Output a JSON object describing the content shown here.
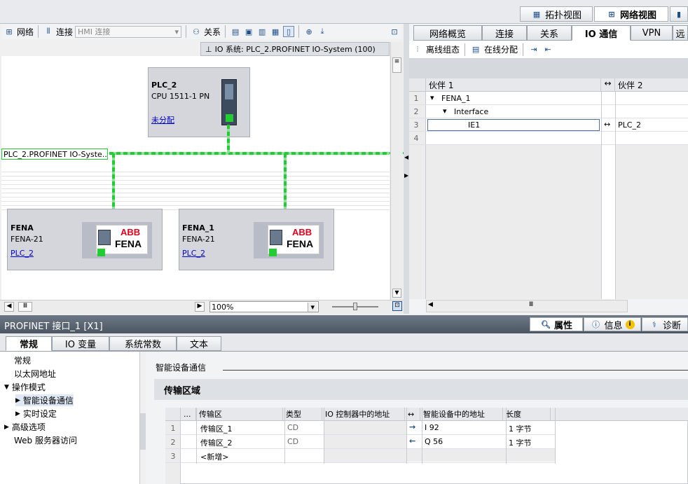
{
  "top_tabs": {
    "topology": "拓扑视图",
    "network": "网络视图",
    "device": ""
  },
  "toolbar": {
    "network": "网络",
    "connection": "连接",
    "hmi_connection": "HMI 连接",
    "relation": "关系"
  },
  "io_system_label": "IO 系统: PLC_2.PROFINET IO-System (100)",
  "network_view": {
    "plc": {
      "name": "PLC_2",
      "cpu": "CPU 1511-1 PN",
      "assign": "未分配"
    },
    "bus_label": "PLC_2.PROFINET IO-Syste...",
    "devices": [
      {
        "name": "FENA",
        "type": "FENA-21",
        "master": "PLC_2",
        "brand": "ABB",
        "logo_text": "FENA"
      },
      {
        "name": "FENA_1",
        "type": "FENA-21",
        "master": "PLC_2",
        "brand": "ABB",
        "logo_text": "FENA"
      }
    ],
    "zoom": "100%"
  },
  "right_tabs": [
    "网络概览",
    "连接",
    "关系",
    "IO 通信",
    "VPN",
    "远"
  ],
  "right_toolbar": {
    "offline": "离线组态",
    "online": "在线分配"
  },
  "partner_table": {
    "col1": "伙伴 1",
    "col2": "伙伴 2",
    "rows": [
      {
        "num": "1",
        "name": "FENA_1",
        "partner": ""
      },
      {
        "num": "2",
        "name": "Interface",
        "partner": ""
      },
      {
        "num": "3",
        "name": "IE1",
        "partner": "PLC_2"
      },
      {
        "num": "4",
        "name": "",
        "partner": ""
      }
    ]
  },
  "bottom": {
    "title": "PROFINET 接口_1 [X1]",
    "right_tabs": {
      "properties": "属性",
      "info": "信息",
      "diagnostics": "诊断"
    },
    "tabs": [
      "常规",
      "IO 变量",
      "系统常数",
      "文本"
    ],
    "nav": [
      "常规",
      "以太网地址",
      "操作模式",
      "智能设备通信",
      "实时设定",
      "高级选项",
      "Web 服务器访问"
    ],
    "section_title": "智能设备通信",
    "subsection": "传输区域",
    "table_headers": [
      "...",
      "传输区",
      "类型",
      "IO 控制器中的地址",
      "智能设备中的地址",
      "长度"
    ],
    "table_rows": [
      {
        "num": "1",
        "name": "传输区_1",
        "type": "CD",
        "io_addr": "",
        "dir": "→",
        "dev_addr": "I 92",
        "len": "1 字节"
      },
      {
        "num": "2",
        "name": "传输区_2",
        "type": "CD",
        "io_addr": "",
        "dir": "←",
        "dev_addr": "Q 56",
        "len": "1 字节"
      },
      {
        "num": "3",
        "name": "<新增>",
        "type": "",
        "io_addr": "",
        "dir": "",
        "dev_addr": "",
        "len": ""
      }
    ]
  },
  "colors": {
    "profinet_green": "#22cc33",
    "accent_blue": "#1f4e8a"
  }
}
